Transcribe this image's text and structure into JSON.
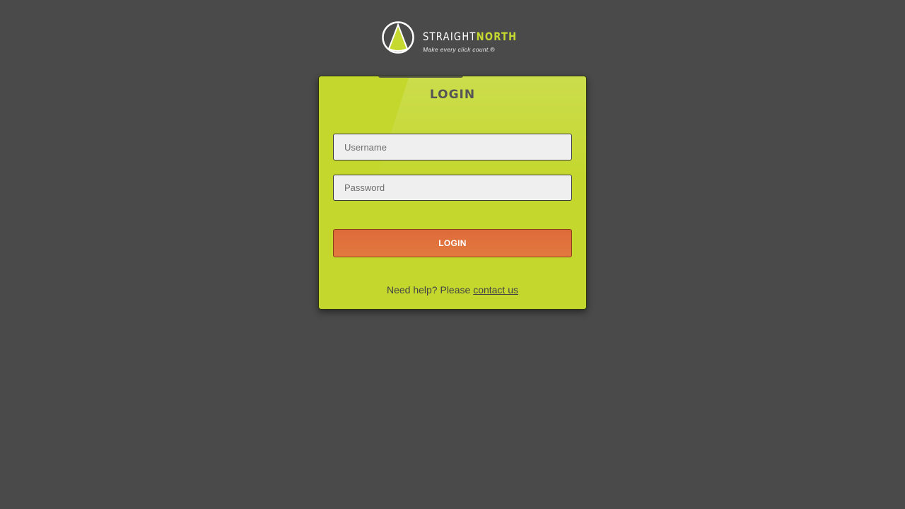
{
  "brand": {
    "name_part1": "STRAIGHT",
    "name_part2": "NORTH",
    "tagline": "Make every click count.®",
    "logo_icon": "north-arrow-circle-icon",
    "accent_color": "#c5d930"
  },
  "login": {
    "title": "LOGIN",
    "username_placeholder": "Username",
    "password_placeholder": "Password",
    "submit_label": "LOGIN",
    "help_text": "Need help? Please ",
    "help_link": "contact us",
    "card_color": "#c3d72d",
    "button_color": "#e0723d"
  }
}
